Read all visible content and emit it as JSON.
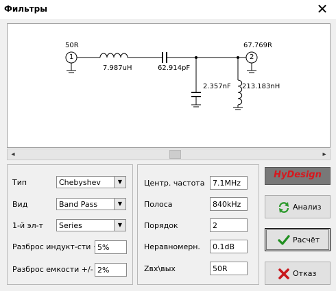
{
  "window": {
    "title": "Фильтры",
    "close_symbol": "✕"
  },
  "schematic": {
    "port1_impedance": "50R",
    "port1_number": "1",
    "port2_impedance": "67.769R",
    "port2_number": "2",
    "series_inductor": "7.987uH",
    "series_capacitor": "62.914pF",
    "shunt_capacitor": "2.357nF",
    "shunt_inductor": "213.183nH"
  },
  "scrollbar": {
    "left_arrow": "◂",
    "right_arrow": "▸"
  },
  "left_panel": {
    "type_label": "Тип",
    "type_value": "Chebyshev",
    "kind_label": "Вид",
    "kind_value": "Band Pass",
    "first_el_label": "1-й эл-т",
    "first_el_value": "Series",
    "ind_tol_label": "Разброс индукт-сти +/-",
    "ind_tol_value": "5%",
    "cap_tol_label": "Разброс емкости +/-",
    "cap_tol_value": "2%"
  },
  "right_panel": {
    "center_freq_label": "Центр. частота",
    "center_freq_value": "7.1MHz",
    "bandwidth_label": "Полоса",
    "bandwidth_value": "840kHz",
    "order_label": "Порядок",
    "order_value": "2",
    "ripple_label": "Неравномерн.",
    "ripple_value": "0.1dB",
    "impedance_label": "Zвх\\вых",
    "impedance_value": "50R"
  },
  "logo": {
    "text": "HyDesign",
    "color": "#d8171d"
  },
  "buttons": {
    "analyze_label": "Анализ",
    "calculate_label": "Расчёт",
    "cancel_label": "Отказ"
  },
  "icons": {
    "analyze": "refresh-icon",
    "calculate": "check-icon",
    "cancel": "x-icon"
  }
}
